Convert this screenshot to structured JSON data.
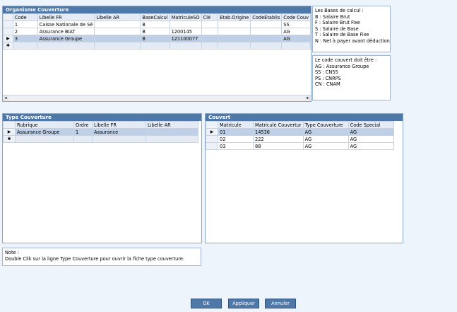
{
  "organisme": {
    "title": "Organisme Couverture",
    "columns": [
      "Code",
      "Libelle FR",
      "Libelle AR",
      "BaseCalcul",
      "MatriculeSO",
      "Clé",
      "Etab.Origine",
      "CodeEtablis",
      "Code Couv"
    ],
    "rows": [
      {
        "marker": "",
        "cells": [
          "1",
          "Caisse Nationale de Sé",
          "",
          "B",
          "",
          "",
          "",
          "",
          "SS"
        ]
      },
      {
        "marker": "",
        "cells": [
          "2",
          "Assurance BIAT",
          "",
          "B",
          "1200145",
          "",
          "",
          "",
          "AG"
        ]
      },
      {
        "marker": "▶",
        "cells": [
          "3",
          "Assurance Groupe",
          "",
          "B",
          "121100077",
          "",
          "",
          "",
          "AG"
        ]
      }
    ],
    "new_row_marker": "✱"
  },
  "bases_note": "Les Bases de calcul :\nB : Salaire Brut\nF : Salaire Brut Fixe\nS : Salaire de Base\nT : Salaire de Base Fixe\nN : Net à payer avant déduction",
  "code_note": "Le code couvert doit être :\nAG : Assurance Groupe\nSS : CNSS\nPS : CNRPS\nCN : CNAM",
  "type_couverture": {
    "title": "Type Couverture",
    "columns": [
      "Rubrique",
      "Ordre",
      "Libelle FR",
      "Libelle AR"
    ],
    "rows": [
      {
        "marker": "▶",
        "cells": [
          "Assurance Groupe",
          "1",
          "Assurance",
          ""
        ]
      }
    ],
    "new_row_marker": "✱"
  },
  "couvert": {
    "title": "Couvert",
    "columns": [
      "Matricule",
      "Matricule Couvertur",
      "Type Couverture",
      "Code Special"
    ],
    "rows": [
      {
        "marker": "▶",
        "cells": [
          "01",
          "14536",
          "AG",
          "AG"
        ]
      },
      {
        "marker": "",
        "cells": [
          "02",
          "222",
          "AG",
          "AG"
        ]
      },
      {
        "marker": "",
        "cells": [
          "03",
          "88",
          "AG",
          "AG"
        ]
      }
    ]
  },
  "note": "Note :\nDouble Clik sur la ligne Type Couverture pour ouvrir la fiche type couverture.",
  "buttons": {
    "ok": "OK",
    "apply": "Appliquer",
    "cancel": "Annuler"
  },
  "scroll": {
    "left": "◂",
    "right": "▸"
  }
}
